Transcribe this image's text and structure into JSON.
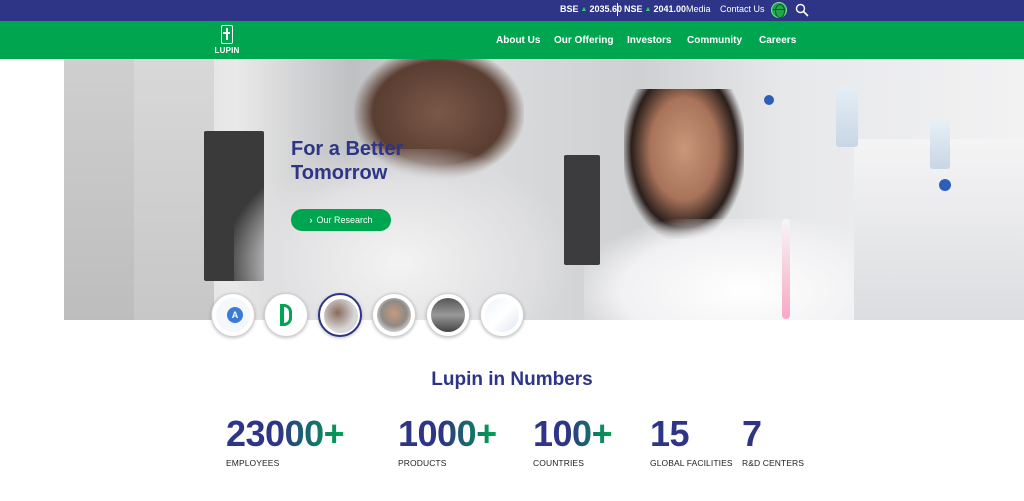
{
  "topbar": {
    "bse_label": "BSE",
    "bse_value": "2035.60",
    "nse_label": "NSE",
    "nse_value": "2041.00",
    "links": [
      "Media",
      "Contact Us"
    ]
  },
  "brand": {
    "logo_text": "LUPIN"
  },
  "nav": {
    "items": [
      "About Us",
      "Our Offering",
      "Investors",
      "Community",
      "Careers"
    ]
  },
  "hero": {
    "title_line1": "For a Better",
    "title_line2": "Tomorrow",
    "cta_label": "Our Research",
    "slide_count": 6,
    "active_slide": 3
  },
  "numbers": {
    "title": "Lupin in Numbers",
    "stats": [
      {
        "value": "23000+",
        "label": "EMPLOYEES"
      },
      {
        "value": "1000+",
        "label": "PRODUCTS"
      },
      {
        "value": "100+",
        "label": "COUNTRIES"
      },
      {
        "value": "15",
        "label": "GLOBAL FACILITIES"
      },
      {
        "value": "7",
        "label": "R&D CENTERS"
      }
    ]
  },
  "colors": {
    "brand_blue": "#2e3586",
    "brand_green": "#00a54f"
  }
}
